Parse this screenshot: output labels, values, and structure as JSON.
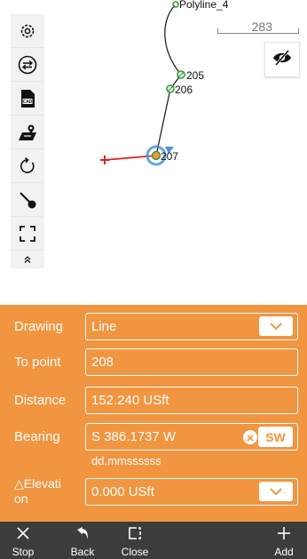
{
  "map": {
    "polyline_label": "Polyline_4",
    "scale_value": "283",
    "points": [
      {
        "name": "205"
      },
      {
        "name": "206"
      },
      {
        "name": "207"
      }
    ]
  },
  "toolbar": {
    "icons": [
      "gear-icon",
      "swap-icon",
      "cad-icon",
      "map-layers-icon",
      "refresh-icon",
      "stakeout-pole-icon",
      "fullscreen-icon",
      "collapse-up-icon"
    ]
  },
  "form": {
    "drawing": {
      "label": "Drawing",
      "value": "Line"
    },
    "to_point": {
      "label": "To point",
      "value": "208"
    },
    "distance": {
      "label": "Distance",
      "value": "152.240 USft"
    },
    "bearing": {
      "label": "Bearing",
      "value": "S 386.1737 W",
      "quadrant_button": "SW",
      "format_hint": "dd.mmssssss"
    },
    "elevation": {
      "label_line1": "△Elevati",
      "label_line2": "on",
      "value": "0.000 USft"
    }
  },
  "bottom_bar": {
    "stop": "Stop",
    "back": "Back",
    "close": "Close",
    "add": "Add"
  },
  "colors": {
    "panel": "#f29540",
    "bottom_bar": "#3c3c3c",
    "line_green": "#2e9b2e",
    "line_red": "#e0201f",
    "selection_blue": "#4a90e2"
  }
}
